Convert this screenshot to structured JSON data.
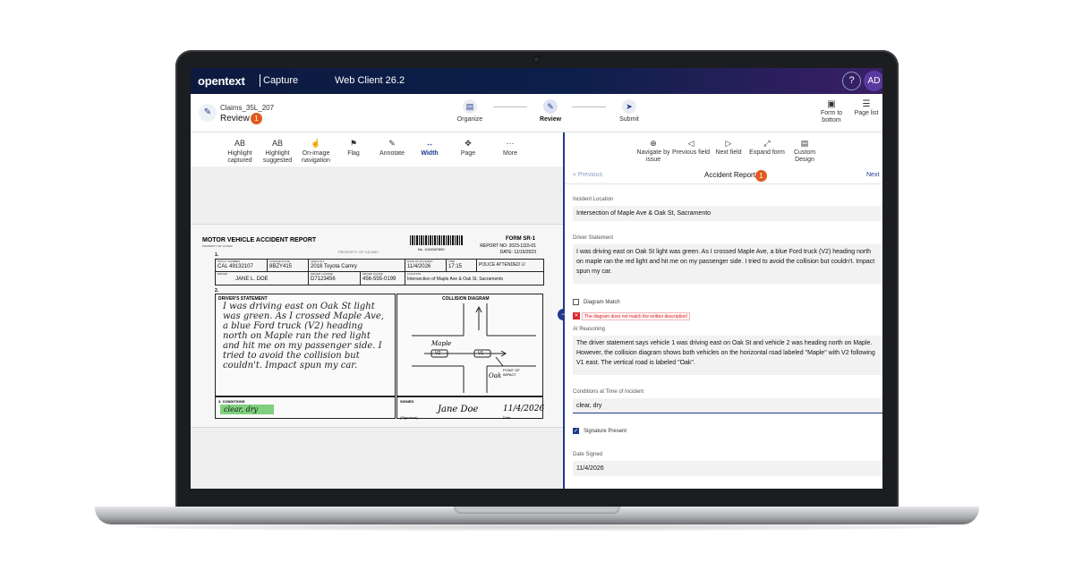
{
  "app": {
    "brand": "opentext",
    "product": "Capture",
    "client": "Web Client 26.2",
    "help_label": "?",
    "user_initials": "AD"
  },
  "workflow": {
    "batch_name": "Claims_35L_207",
    "current_step": "Review",
    "step_badge": "1",
    "steps": [
      {
        "label": "Organize",
        "icon": "document-icon"
      },
      {
        "label": "Review",
        "icon": "pencil-icon"
      },
      {
        "label": "Submit",
        "icon": "send-icon"
      }
    ],
    "right_actions": [
      {
        "label": "Form to bottom",
        "icon": "layout-icon"
      },
      {
        "label": "Page list",
        "icon": "list-icon"
      }
    ]
  },
  "viewer_tools": [
    {
      "label": "Highlight captured",
      "icon": "AB"
    },
    {
      "label": "Highlight suggested",
      "icon": "AB"
    },
    {
      "label": "On-image navigation",
      "icon": "☝"
    },
    {
      "label": "Flag",
      "icon": "⚑"
    },
    {
      "label": "Annotate",
      "icon": "✎"
    },
    {
      "label": "Width",
      "icon": "↔"
    },
    {
      "label": "Page",
      "icon": "✥"
    },
    {
      "label": "More",
      "icon": "···"
    }
  ],
  "document": {
    "title": "MOTOR VEHICLE ACCIDENT REPORT",
    "owner": "PROPERTY OF CA DMV",
    "property_mark": "PROPERTY OF CA DMV",
    "barcode_number": "No. 1024067890",
    "form_no": "FORM SR-1",
    "report_no": "REPORT NO: 2023-1115-01",
    "report_date": "DATE: 11/15/2023",
    "fields_row1": [
      {
        "caption": "POLICY NUMBER",
        "value": "CAL 49132107"
      },
      {
        "caption": "LICENSE PLATE",
        "value": "8BZY415"
      },
      {
        "caption": "VEHICLE 1",
        "value": "2018 Toyota Camry"
      },
      {
        "caption": "DATE OF ACCIDENT",
        "value": "11/4/2026"
      },
      {
        "caption": "TIME",
        "value": "17:15"
      },
      {
        "caption": "",
        "value": "POLICE ATTENDED ☑"
      }
    ],
    "fields_row2": [
      {
        "caption": "DRIVER",
        "value": "JANE L. DOE"
      },
      {
        "caption": "DRIVER LICENSE",
        "value": "D7123456"
      },
      {
        "caption": "DRIVER PHONE",
        "value": "456-555-0199"
      },
      {
        "caption": "LOCATION",
        "value": "Intersection of Maple Ave & Oak St, Sacramento"
      }
    ],
    "statement_caption": "DRIVER'S STATEMENT",
    "statement_handwriting": "I was driving east on Oak St light was green. As I crossed Maple Ave, a blue Ford truck (V2) heading north on Maple ran the red light and hit me on my passenger side. I tried to avoid the collision but couldn't. Impact spun my car.",
    "diagram_caption": "COLLISION DIAGRAM",
    "diagram_labels": {
      "road_h": "Maple",
      "road_v": "Oak",
      "v1": "V1",
      "v2": "V2",
      "impact": "POINT OF IMPACT"
    },
    "conditions_caption": "3. CONDITIONS",
    "conditions_value": "clear, dry",
    "signed_caption": "SIGNED",
    "signature": "Jane Doe",
    "signed_date": "11/4/2026",
    "signature_label": "(Signature)",
    "date_label": "Date"
  },
  "right_tools": [
    {
      "label": "Navigate by issue",
      "icon": "⊕"
    },
    {
      "label": "Previous field",
      "icon": "◁"
    },
    {
      "label": "Next field",
      "icon": "▷"
    },
    {
      "label": "Expand form",
      "icon": "⤢"
    },
    {
      "label": "Custom Design",
      "icon": "▤"
    }
  ],
  "form_nav": {
    "previous": "« Previous",
    "next": "Next",
    "title": "Accident Report",
    "badge": "1"
  },
  "fields": {
    "incident_location": {
      "label": "Incident Location",
      "value": "Intersection of Maple Ave & Oak St, Sacramento"
    },
    "driver_statement": {
      "label": "Driver Statement",
      "value": "I was driving east on Oak St light was green. As I crossed Maple Ave, a blue Ford truck (V2) heading north on maple ran the red light and hit me on my passenger side. I tried to avoid the collision but couldn't. Impact spun my car."
    },
    "diagram_match": {
      "label": "Diagram Match",
      "checked": false,
      "error": "The diagram does not match the written description!"
    },
    "ai_reasoning": {
      "label": "AI Reasoning",
      "value": "The driver statement says vehicle 1 was driving east on Oak St and vehicle 2 was heading north on Maple. However, the collision diagram shows both vehicles on the horizontal road labeled \"Maple\" with V2 following V1 east. The vertical road is labeled \"Oak\"."
    },
    "conditions": {
      "label": "Conditions at Time of Incident",
      "value": "clear, dry"
    },
    "signature_present": {
      "label": "Signature Present",
      "checked": true
    },
    "date_signed": {
      "label": "Date Signed",
      "value": "11/4/2026"
    }
  },
  "colors": {
    "accent": "#203a8c",
    "badge": "#e05a1e",
    "error": "#d9262c",
    "highlight": "#7fd17f"
  }
}
